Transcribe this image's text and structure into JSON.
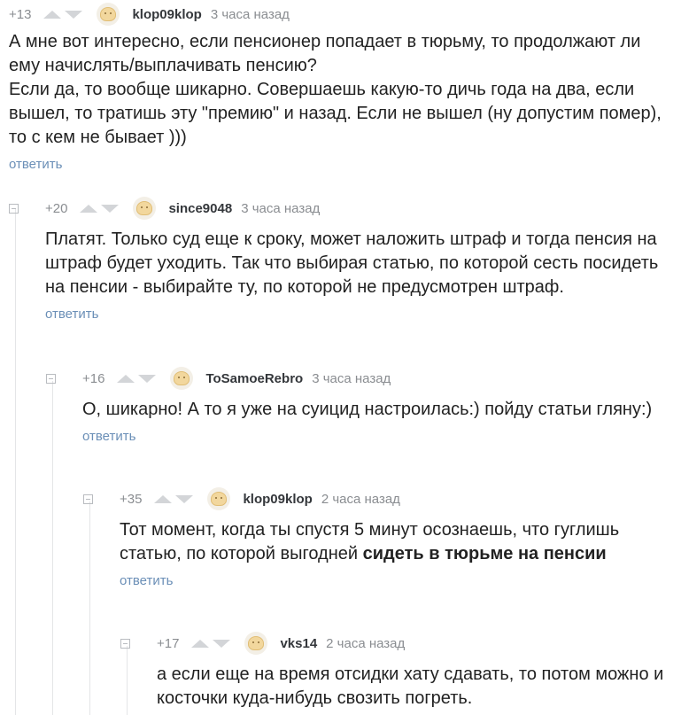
{
  "comments": [
    {
      "rating": "+13",
      "username": "klop09klop",
      "time": "3 часа назад",
      "text": [
        "А мне вот интересно, если пенсионер попадает в тюрьму, то продолжают ли ему начислять/выплачивать пенсию?",
        "Если да, то вообще шикарно. Совершаешь какую-то дичь года на два, если вышел, то тратишь эту \"премию\"  и назад. Если не вышел (ну допустим помер), то с кем не бывает )))"
      ],
      "reply_label": "ответить"
    },
    {
      "rating": "+20",
      "username": "since9048",
      "time": "3 часа назад",
      "text": [
        "Платят. Только суд еще к сроку, может наложить штраф и тогда пенсия на штраф будет уходить. Так что выбирая статью, по которой сесть посидеть на пенсии - выбирайте ту, по которой не предусмотрен штраф."
      ],
      "reply_label": "ответить"
    },
    {
      "rating": "+16",
      "username": "ToSamoeRebro",
      "time": "3 часа назад",
      "text": [
        "О, шикарно! А то я уже на суицид настроилась:) пойду статьи гляну:)"
      ],
      "reply_label": "ответить"
    },
    {
      "rating": "+35",
      "username": "klop09klop",
      "time": "2 часа назад",
      "text_plain": "Тот момент, когда ты спустя 5 минут осознаешь, что гуглишь статью, по которой выгодней ",
      "text_bold": "сидеть в тюрьме на пенсии",
      "reply_label": "ответить"
    },
    {
      "rating": "+17",
      "username": "vks14",
      "time": "2 часа назад",
      "text": [
        "а если еще на время отсидки хату сдавать, то потом можно и косточки куда-нибудь свозить погреть."
      ]
    }
  ]
}
